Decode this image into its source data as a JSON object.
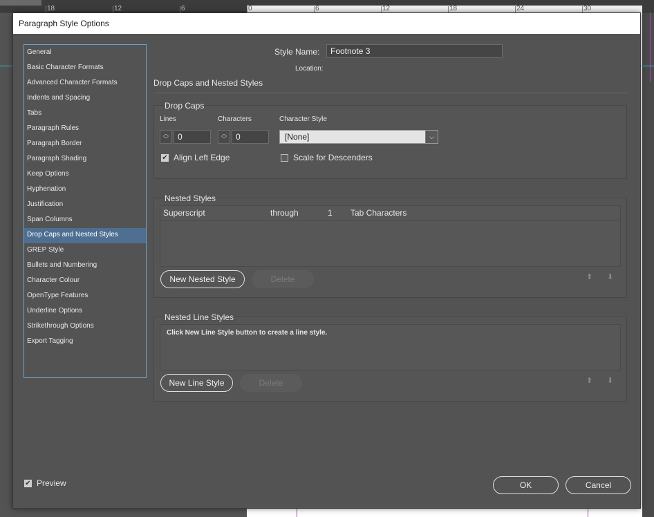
{
  "ruler": {
    "numbers": [
      "18",
      "12",
      "6",
      "0",
      "6",
      "12",
      "18",
      "24",
      "30"
    ]
  },
  "dialog": {
    "title": "Paragraph Style Options"
  },
  "sidebar": {
    "items": [
      {
        "label": "General"
      },
      {
        "label": "Basic Character Formats"
      },
      {
        "label": "Advanced Character Formats"
      },
      {
        "label": "Indents and Spacing"
      },
      {
        "label": "Tabs"
      },
      {
        "label": "Paragraph Rules"
      },
      {
        "label": "Paragraph Border"
      },
      {
        "label": "Paragraph Shading"
      },
      {
        "label": "Keep Options"
      },
      {
        "label": "Hyphenation"
      },
      {
        "label": "Justification"
      },
      {
        "label": "Span Columns"
      },
      {
        "label": "Drop Caps and Nested Styles"
      },
      {
        "label": "GREP Style"
      },
      {
        "label": "Bullets and Numbering"
      },
      {
        "label": "Character Colour"
      },
      {
        "label": "OpenType Features"
      },
      {
        "label": "Underline Options"
      },
      {
        "label": "Strikethrough Options"
      },
      {
        "label": "Export Tagging"
      }
    ],
    "active_index": 12
  },
  "style_name": {
    "label": "Style Name:",
    "value": "Footnote 3",
    "location_label": "Location:"
  },
  "section_title": "Drop Caps and Nested Styles",
  "drop_caps": {
    "title": "Drop Caps",
    "lines_label": "Lines",
    "lines_value": "0",
    "characters_label": "Characters",
    "characters_value": "0",
    "char_style_label": "Character Style",
    "char_style_value": "[None]",
    "align_left_edge_label": "Align Left Edge",
    "align_left_edge_checked": true,
    "scale_descenders_label": "Scale for Descenders",
    "scale_descenders_checked": false
  },
  "nested_styles": {
    "title": "Nested Styles",
    "rows": [
      {
        "style": "Superscript",
        "mode": "through",
        "count": "1",
        "unit": "Tab Characters"
      }
    ],
    "new_button": "New Nested Style",
    "delete_button": "Delete"
  },
  "nested_line_styles": {
    "title": "Nested Line Styles",
    "hint": "Click New Line Style button to create a line style.",
    "new_button": "New Line Style",
    "delete_button": "Delete"
  },
  "footer": {
    "preview_label": "Preview",
    "preview_checked": true,
    "ok_button": "OK",
    "cancel_button": "Cancel"
  },
  "icons": {
    "checkmark": "✔",
    "chevron_down": "⌵",
    "spin_up": "︿",
    "spin_down": "﹀",
    "move_up": "⬆",
    "move_down": "⬇"
  }
}
